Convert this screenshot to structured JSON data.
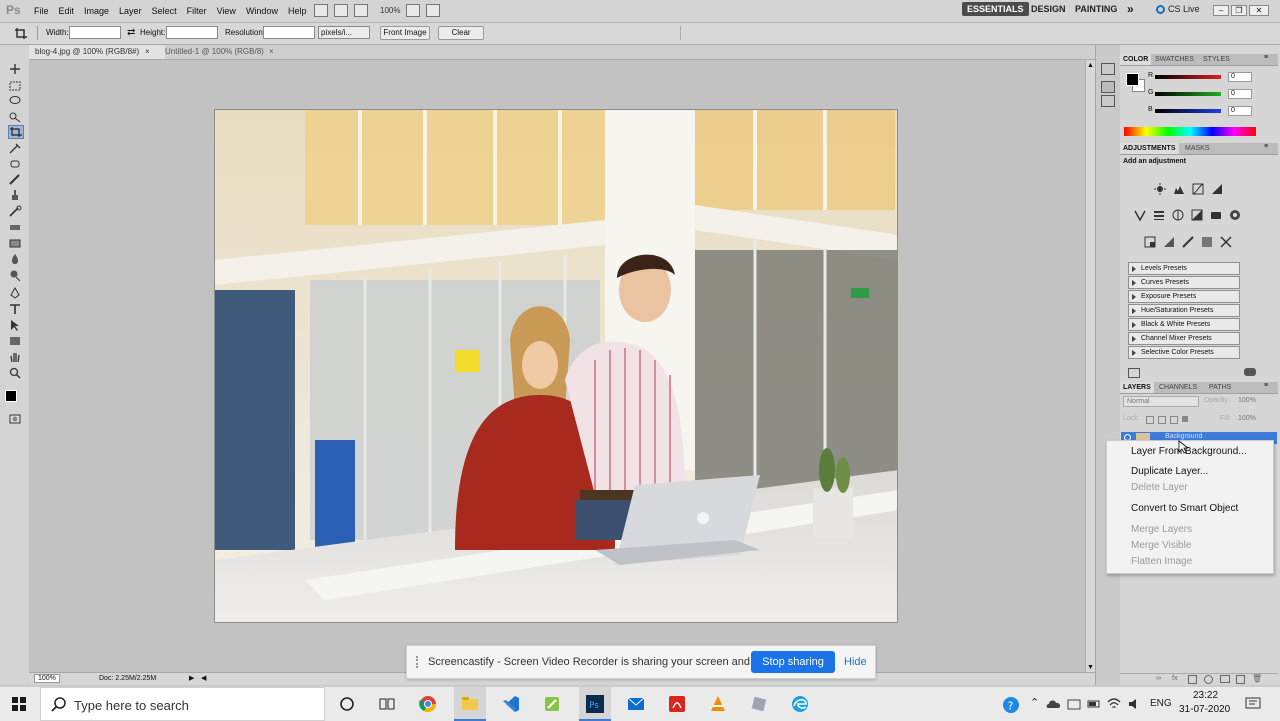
{
  "app": {
    "logo": "Ps",
    "menus": [
      "File",
      "Edit",
      "Image",
      "Layer",
      "Select",
      "Filter",
      "View",
      "Window",
      "Help"
    ],
    "zoom": "100%",
    "workspaces": [
      "ESSENTIALS",
      "DESIGN",
      "PAINTING"
    ],
    "active_workspace": "ESSENTIALS",
    "more": "»",
    "cs_live": "CS Live"
  },
  "options_bar": {
    "width_label": "Width:",
    "width_value": "",
    "height_label": "Height:",
    "height_value": "",
    "resolution_label": "Resolution:",
    "resolution_value": "",
    "unit": "pixels/i...",
    "front_image": "Front Image",
    "clear": "Clear"
  },
  "documents": {
    "tabs": [
      "blog-4.jpg @ 100% (RGB/8#)",
      "Untitled-1 @ 100% (RGB/8)"
    ],
    "active_index": 0
  },
  "status_bar": {
    "zoom": "100%",
    "doc": "Doc: 2.25M/2.25M"
  },
  "color_panel": {
    "tabs": [
      "COLOR",
      "SWATCHES",
      "STYLES"
    ],
    "channels": [
      {
        "label": "R",
        "value": "0",
        "color": "#e02020"
      },
      {
        "label": "G",
        "value": "0",
        "color": "#20b020"
      },
      {
        "label": "B",
        "value": "0",
        "color": "#2040e0"
      }
    ]
  },
  "adjustments_panel": {
    "tabs": [
      "ADJUSTMENTS",
      "MASKS"
    ],
    "heading": "Add an adjustment",
    "presets": [
      "Levels Presets",
      "Curves Presets",
      "Exposure Presets",
      "Hue/Saturation Presets",
      "Black & White Presets",
      "Channel Mixer Presets",
      "Selective Color Presets"
    ]
  },
  "layers_panel": {
    "tabs": [
      "LAYERS",
      "CHANNELS",
      "PATHS"
    ],
    "blend_mode": "Normal",
    "opacity_label": "Opacity:",
    "opacity": "100%",
    "lock_label": "Lock:",
    "fill_label": "Fill:",
    "fill": "100%",
    "layer_name": "Background"
  },
  "context_menu": {
    "items": [
      {
        "label": "Layer From Background...",
        "enabled": true
      },
      {
        "label": "Duplicate Layer...",
        "enabled": true
      },
      {
        "label": "Delete Layer",
        "enabled": false
      },
      {
        "label": "Convert to Smart Object",
        "enabled": true
      },
      {
        "label": "Merge Layers",
        "enabled": false
      },
      {
        "label": "Merge Visible",
        "enabled": false
      },
      {
        "label": "Flatten Image",
        "enabled": false
      }
    ]
  },
  "notification": {
    "message": "Screencastify - Screen Video Recorder is sharing your screen and audio.",
    "stop_label": "Stop sharing",
    "hide_label": "Hide"
  },
  "taskbar": {
    "search_placeholder": "Type here to search",
    "language": "ENG",
    "time": "23:22",
    "date": "31-07-2020"
  }
}
